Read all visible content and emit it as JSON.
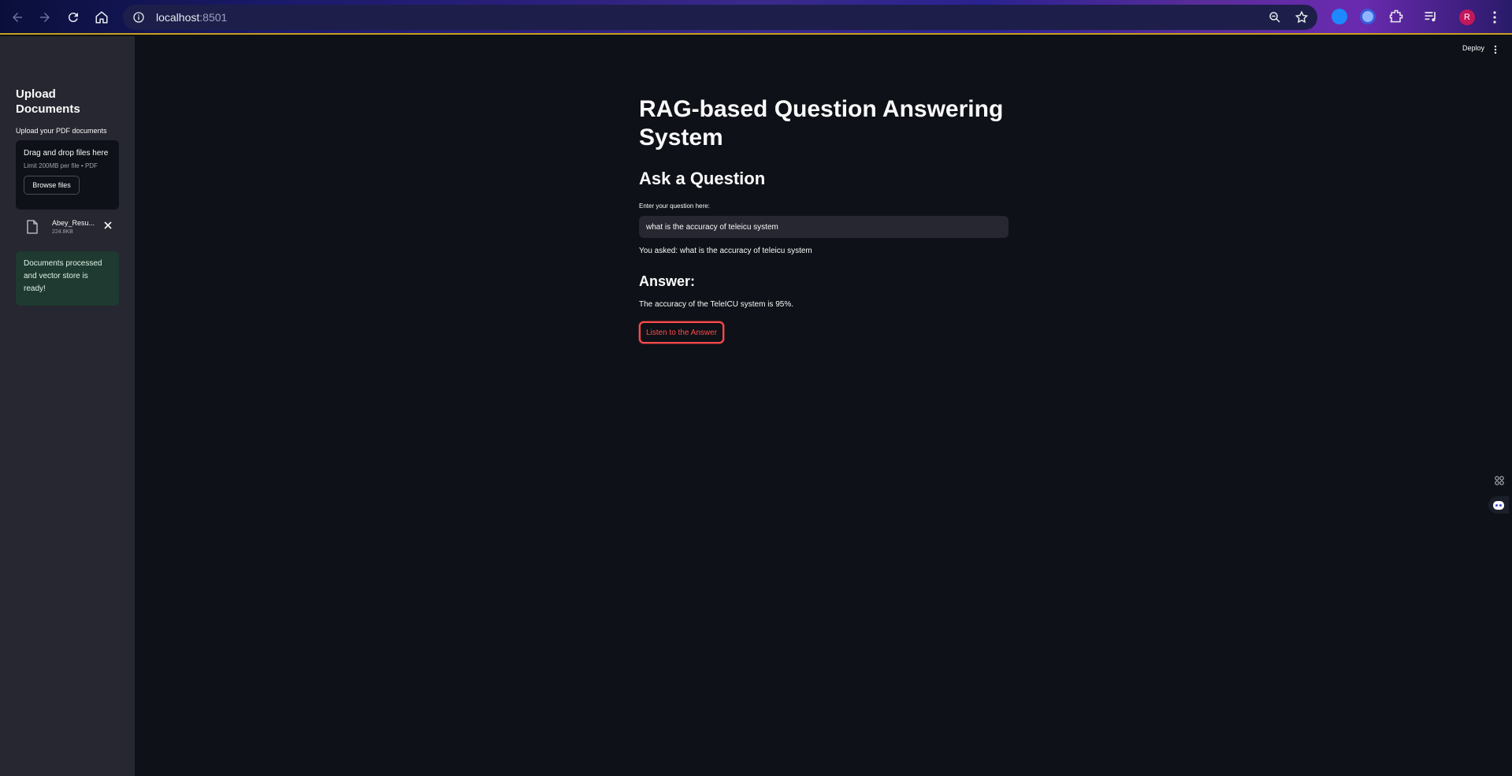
{
  "browser": {
    "url_host": "localhost",
    "url_port": ":8501",
    "profile_initial": "R"
  },
  "sidebar": {
    "title": "Upload Documents",
    "upload_label": "Upload your PDF documents",
    "dropzone_title": "Drag and drop files here",
    "dropzone_limit": "Limit 200MB per file • PDF",
    "browse_label": "Browse files",
    "file": {
      "name": "Abey_Resu...",
      "size": "224.8KB"
    },
    "success_message": "Documents processed and vector store is ready!"
  },
  "header": {
    "deploy_label": "Deploy"
  },
  "main": {
    "title": "RAG-based Question Answering System",
    "ask_heading": "Ask a Question",
    "question_label": "Enter your question here:",
    "question_value": "what is the accuracy of teleicu system",
    "asked_text": "You asked: what is the accuracy of teleicu system",
    "answer_heading": "Answer:",
    "answer_text": "The accuracy of the TeleICU system is 95%.",
    "listen_label": "Listen to the Answer"
  },
  "colors": {
    "background": "#0e1117",
    "sidebar": "#262730",
    "accent": "#ff4b4b",
    "success_bg": "#1f3a30"
  }
}
